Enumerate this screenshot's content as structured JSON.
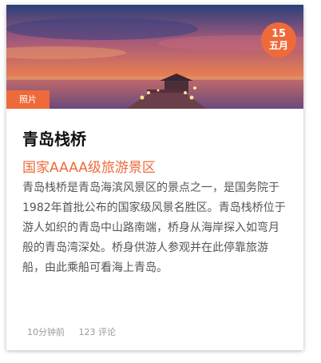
{
  "card": {
    "date": {
      "day": "15",
      "month": "五月"
    },
    "photo_tag": "照片",
    "title": "青岛栈桥",
    "subtitle": "国家AAAA级旅游景区",
    "description": "青岛栈桥是青岛海滨风景区的景点之一，是国务院于1982年首批公布的国家级风景名胜区。青岛栈桥位于游人如织的青岛中山路南端，桥身从海岸探入如弯月般的青岛湾深处。桥身供游人参观并在此停靠旅游船，由此乘船可看海上青岛。",
    "time_ago": "10分钟前",
    "comments": "123 评论"
  },
  "colors": {
    "accent": "#ef6a3a"
  }
}
